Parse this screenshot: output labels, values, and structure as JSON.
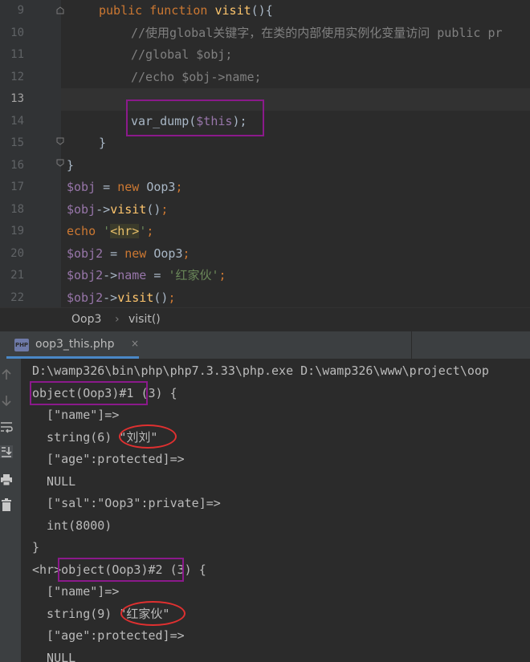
{
  "editor": {
    "line_numbers": [
      "9",
      "10",
      "11",
      "12",
      "13",
      "14",
      "15",
      "16",
      "17",
      "18",
      "19",
      "20",
      "21",
      "22"
    ],
    "code": {
      "l9_kw1": "public",
      "l9_kw2": "function",
      "l9_fn": "visit",
      "l9_rest": "(){",
      "l10": "//使用global关键字，在类的内部使用实例化变量访问 public pr",
      "l11": "//global $obj;",
      "l12": "//echo $obj->name;",
      "l14_fn": "var_dump",
      "l14_paren": "(",
      "l14_var": "$this",
      "l14_close": ");",
      "l15": "}",
      "l16": "}",
      "l17_var": "$obj",
      "l17_eq": " = ",
      "l17_kw": "new",
      "l17_cls": " Oop3",
      "l17_semi": ";",
      "l18_var": "$obj",
      "l18_arrow": "->",
      "l18_fn": "visit",
      "l18_rest": "()",
      "l18_semi": ";",
      "l19_kw": "echo",
      "l19_q1": " '",
      "l19_tag": "<hr>",
      "l19_q2": "'",
      "l19_semi": ";",
      "l20_var": "$obj2",
      "l20_eq": " = ",
      "l20_kw": "new",
      "l20_cls": " Oop3",
      "l20_semi": ";",
      "l21_var": "$obj2",
      "l21_arrow": "->",
      "l21_prop": "name",
      "l21_eq": " = ",
      "l21_str": "'红家伙'",
      "l21_semi": ";",
      "l22_var": "$obj2",
      "l22_arrow": "->",
      "l22_fn": "visit",
      "l22_rest": "()",
      "l22_semi": ";"
    }
  },
  "breadcrumb": {
    "class": "Oop3",
    "sep": "›",
    "method": "visit()"
  },
  "run_tab": {
    "label": "oop3_this.php",
    "icon_text": "PHP",
    "close": "×"
  },
  "console": {
    "lines": [
      "D:\\wamp326\\bin\\php\\php7.3.33\\php.exe D:\\wamp326\\www\\project\\oop",
      "object(Oop3)#1 (3) {",
      "  [\"name\"]=>",
      "  string(6) \"刘刘\"",
      "  [\"age\":protected]=>",
      "  NULL",
      "  [\"sal\":\"Oop3\":private]=>",
      "  int(8000)",
      "}",
      "<hr>object(Oop3)#2 (3) {",
      "  [\"name\"]=>",
      "  string(9) \"红家伙\"",
      "  [\"age\":protected]=>",
      "  NULL"
    ]
  },
  "colors": {
    "keyword": "#cc7832",
    "function": "#ffc66d",
    "variable": "#9876aa",
    "comment": "#808080",
    "string": "#6a8759",
    "highlight_box": "#8b1a8b",
    "ellipse": "#e03030"
  }
}
